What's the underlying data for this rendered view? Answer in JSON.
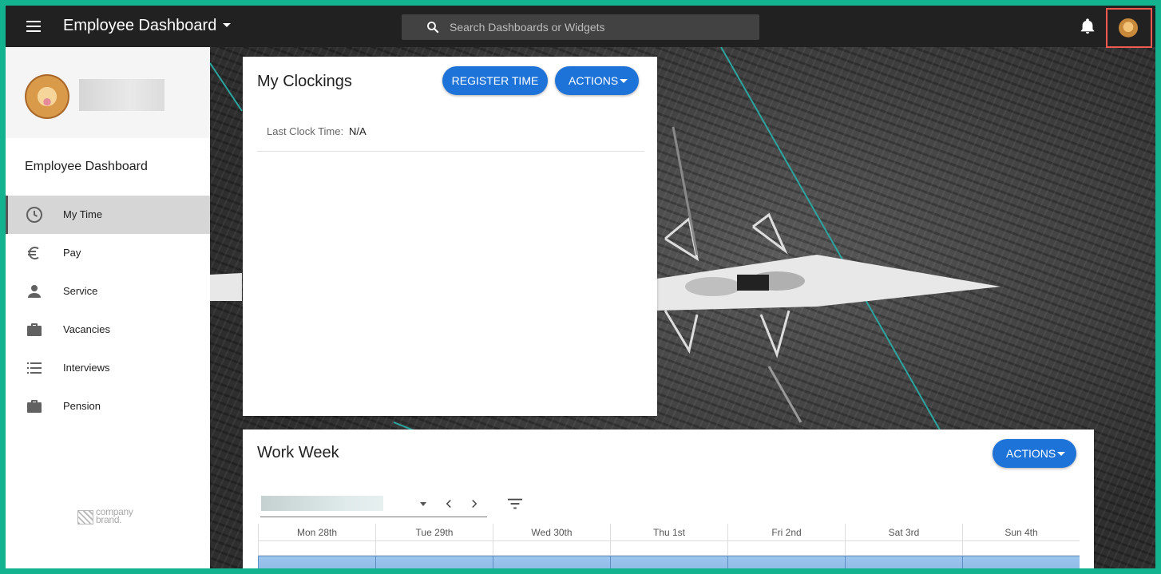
{
  "topbar": {
    "title": "Employee Dashboard",
    "search_placeholder": "Search Dashboards or Widgets"
  },
  "sidebar": {
    "title": "Employee Dashboard",
    "items": [
      {
        "label": "My Time",
        "icon": "clock-icon",
        "active": true
      },
      {
        "label": "Pay",
        "icon": "euro-icon",
        "active": false
      },
      {
        "label": "Service",
        "icon": "person-icon",
        "active": false
      },
      {
        "label": "Vacancies",
        "icon": "briefcase-icon",
        "active": false
      },
      {
        "label": "Interviews",
        "icon": "list-icon",
        "active": false
      },
      {
        "label": "Pension",
        "icon": "briefcase-icon",
        "active": false
      }
    ],
    "brand_line1": "company",
    "brand_line2": "brand."
  },
  "clockings": {
    "title": "My Clockings",
    "register_label": "REGISTER TIME",
    "actions_label": "ACTIONS",
    "last_clock_label": "Last Clock Time:",
    "last_clock_value": "N/A"
  },
  "workweek": {
    "title": "Work Week",
    "actions_label": "ACTIONS",
    "days": [
      "Mon 28th",
      "Tue 29th",
      "Wed 30th",
      "Thu 1st",
      "Fri 2nd",
      "Sat 3rd",
      "Sun 4th"
    ]
  },
  "colors": {
    "accent": "#1e73d8",
    "frame": "#14b38f",
    "topbar": "#212121",
    "highlight_border": "#f05a50"
  }
}
